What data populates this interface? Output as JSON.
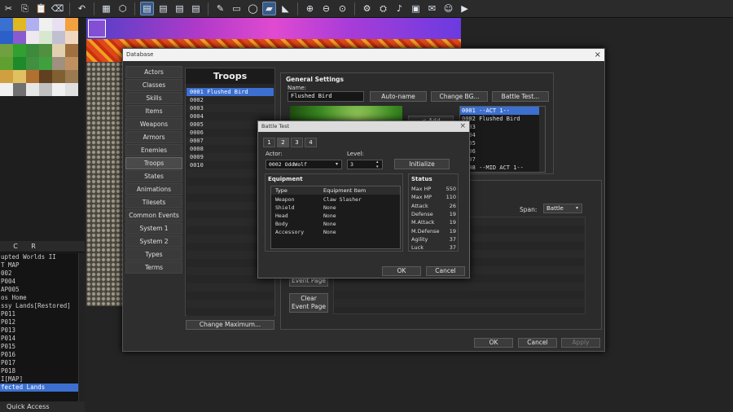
{
  "toolbar": {
    "icons": [
      "cut-icon",
      "copy-icon",
      "paste-icon",
      "delete-icon",
      "undo-icon",
      "map-mode-icon",
      "event-mode-icon",
      "layer-1-icon",
      "layer-2-icon",
      "layer-3-icon",
      "layer-4-icon",
      "pencil-icon",
      "rectangle-icon",
      "ellipse-icon",
      "fill-icon",
      "shadow-pen-icon",
      "zoom-in-icon",
      "zoom-out-icon",
      "zoom-actual-icon",
      "database-icon",
      "plugin-icon",
      "sound-test-icon",
      "event-searcher-icon",
      "resource-manager-icon",
      "character-generator-icon",
      "playtest-icon"
    ]
  },
  "map_tabs": [
    "C",
    "R"
  ],
  "map_tree": [
    "upted Worlds II",
    "T MAP",
    "002",
    "P004",
    "AP005",
    "os Home",
    "ssy Lands[Restored]",
    "P011",
    "P012",
    "P013",
    "P014",
    "P015",
    "P016",
    "P017",
    "P018",
    "I[MAP]",
    "fected Lands"
  ],
  "map_tree_selected": 16,
  "quick_access": "Quick Access",
  "database": {
    "title": "Database",
    "close": "×",
    "categories": [
      "Actors",
      "Classes",
      "Skills",
      "Items",
      "Weapons",
      "Armors",
      "Enemies",
      "Troops",
      "States",
      "Animations",
      "Tilesets",
      "Common Events",
      "System 1",
      "System 2",
      "Types",
      "Terms"
    ],
    "selected_category": 7,
    "troops_header": "Troops",
    "troops": [
      "0001 Flushed Bird",
      "0002",
      "0003",
      "0004",
      "0005",
      "0006",
      "0007",
      "0008",
      "0009",
      "0010"
    ],
    "change_max": "Change Maximum...",
    "general": {
      "title": "General Settings",
      "name_label": "Name:",
      "name_value": "Flushed Bird",
      "auto_name": "Auto-name",
      "change_bg": "Change BG...",
      "battle_test": "Battle Test...",
      "add": "< Add",
      "members": [
        "0001 --ACT 1--",
        "0002 Flushed Bird",
        "0003",
        "0004",
        "0005",
        "0006",
        "0007",
        "0008 --MID ACT 1--"
      ]
    },
    "event_pages": {
      "span_label": "Span:",
      "span_value": "Battle",
      "event_page": "Event Page",
      "clear_event_page": "Clear\nEvent Page"
    },
    "ok": "OK",
    "cancel": "Cancel",
    "apply": "Apply"
  },
  "battle_test": {
    "title": "Battle Test",
    "close": "×",
    "tabs": [
      "1",
      "2",
      "3",
      "4"
    ],
    "selected_tab": 1,
    "actor_label": "Actor:",
    "actor_value": "0002 OddWolf",
    "level_label": "Level:",
    "level_value": "3",
    "initialize": "Initialize",
    "equipment_title": "Equipment",
    "equip_headers": [
      "Type",
      "Equipment Item"
    ],
    "equipment": [
      {
        "type": "Weapon",
        "item": "Claw Slasher"
      },
      {
        "type": "Shield",
        "item": "None"
      },
      {
        "type": "Head",
        "item": "None"
      },
      {
        "type": "Body",
        "item": "None"
      },
      {
        "type": "Accessory",
        "item": "None"
      }
    ],
    "status_title": "Status",
    "status": [
      {
        "name": "Max HP",
        "value": "550"
      },
      {
        "name": "Max MP",
        "value": "110"
      },
      {
        "name": "Attack",
        "value": "26"
      },
      {
        "name": "Defense",
        "value": "19"
      },
      {
        "name": "M.Attack",
        "value": "19"
      },
      {
        "name": "M.Defense",
        "value": "19"
      },
      {
        "name": "Agility",
        "value": "37"
      },
      {
        "name": "Luck",
        "value": "37"
      }
    ],
    "ok": "OK",
    "cancel": "Cancel"
  }
}
